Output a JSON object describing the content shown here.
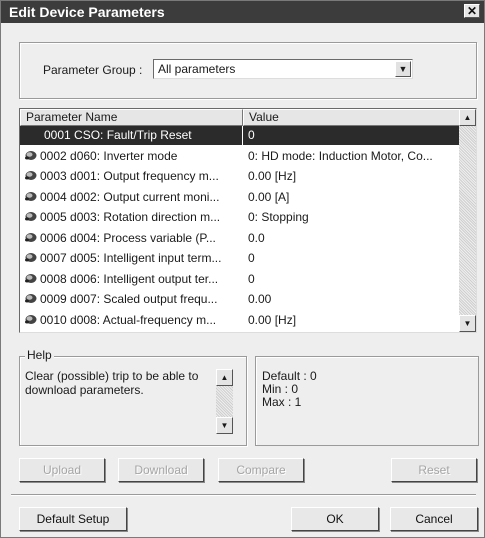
{
  "window": {
    "title": "Edit Device Parameters",
    "close_label": "✕"
  },
  "parameter_group": {
    "label": "Parameter Group :",
    "value": "All parameters"
  },
  "table": {
    "columns": [
      "Parameter Name",
      "Value"
    ],
    "rows": [
      {
        "name": "0001 CSO: Fault/Trip Reset",
        "value": "0",
        "selected": true,
        "icon": "none"
      },
      {
        "name": "0002 d060: Inverter mode",
        "value": "0: HD mode: Induction Motor, Co...",
        "icon": "parameter-icon"
      },
      {
        "name": "0003 d001: Output frequency m...",
        "value": "0.00 [Hz]",
        "icon": "parameter-icon"
      },
      {
        "name": "0004 d002: Output current moni...",
        "value": "0.00 [A]",
        "icon": "parameter-icon"
      },
      {
        "name": "0005 d003: Rotation direction m...",
        "value": "0: Stopping",
        "icon": "parameter-icon"
      },
      {
        "name": "0006 d004: Process variable (P...",
        "value": "0.0",
        "icon": "parameter-icon"
      },
      {
        "name": "0007 d005: Intelligent input term...",
        "value": "0",
        "icon": "parameter-icon"
      },
      {
        "name": "0008 d006: Intelligent output ter...",
        "value": "0",
        "icon": "parameter-icon"
      },
      {
        "name": "0009 d007: Scaled output frequ...",
        "value": "0.00",
        "icon": "parameter-icon"
      },
      {
        "name": "0010 d008: Actual-frequency m...",
        "value": "0.00 [Hz]",
        "icon": "parameter-icon"
      }
    ]
  },
  "help": {
    "title": "Help",
    "text": "Clear (possible) trip to be able to download parameters."
  },
  "info": {
    "default": "Default : 0",
    "min": "Min : 0",
    "max": "Max : 1"
  },
  "buttons": {
    "upload": "Upload",
    "download": "Download",
    "compare": "Compare",
    "reset": "Reset",
    "default_setup": "Default Setup",
    "ok": "OK",
    "cancel": "Cancel"
  }
}
